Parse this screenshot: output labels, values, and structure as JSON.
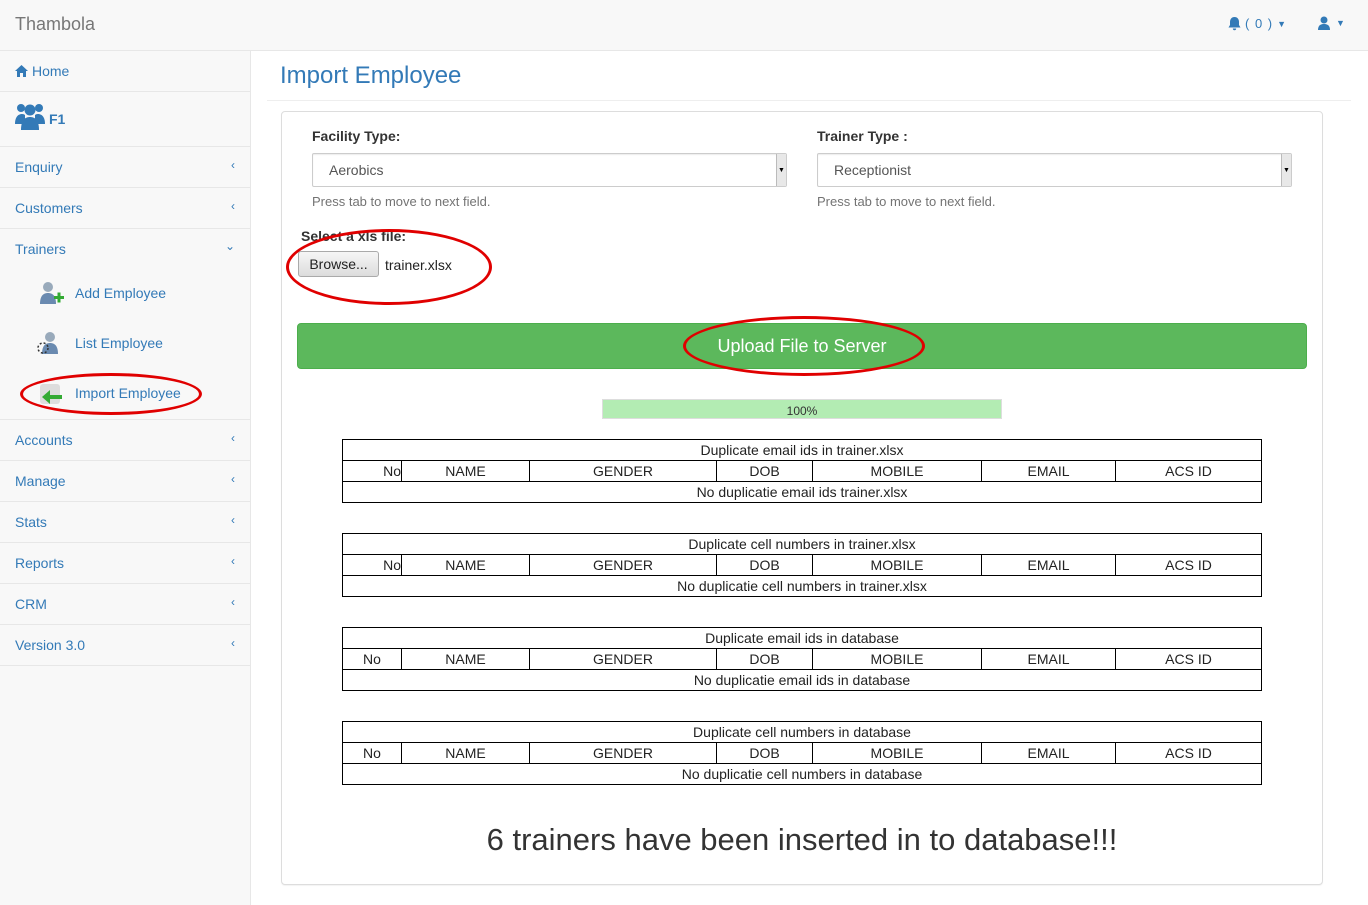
{
  "navbar": {
    "brand": "Thambola",
    "notif_label": "( 0 )"
  },
  "sidebar": {
    "home": "Home",
    "group": "F1",
    "items": [
      {
        "label": "Enquiry"
      },
      {
        "label": "Customers"
      },
      {
        "label": "Trainers"
      },
      {
        "label": "Accounts"
      },
      {
        "label": "Manage"
      },
      {
        "label": "Stats"
      },
      {
        "label": "Reports"
      },
      {
        "label": "CRM"
      },
      {
        "label": "Version 3.0"
      }
    ],
    "trainer_sub": [
      "Add Employee",
      "List Employee",
      "Import Employee"
    ]
  },
  "main": {
    "title": "Import Employee",
    "facility_label": "Facility Type:",
    "facility_value": "Aerobics",
    "trainer_label": "Trainer Type :",
    "trainer_value": "Receptionist",
    "help_text": "Press tab to move to next field.",
    "file_label": "Select a xls file:",
    "browse_label": "Browse...",
    "file_name": "trainer.xlsx",
    "upload_label": "Upload File to Server",
    "progress_text": "100%",
    "progress_value": 100,
    "columns": [
      "No",
      "NAME",
      "GENDER",
      "DOB",
      "MOBILE",
      "EMAIL",
      "ACS ID"
    ],
    "tables": [
      {
        "title": "Duplicate email ids in trainer.xlsx",
        "empty": "No duplicatie email ids trainer.xlsx"
      },
      {
        "title": "Duplicate cell numbers in trainer.xlsx",
        "empty": "No duplicatie cell numbers in trainer.xlsx"
      },
      {
        "title": "Duplicate email ids in database",
        "empty": "No duplicatie email ids in database"
      },
      {
        "title": "Duplicate cell numbers in database",
        "empty": "No duplicatie cell numbers in database"
      }
    ],
    "result": "6 trainers have been inserted in to database!!!"
  },
  "colors": {
    "link": "#337ab7",
    "success": "#5cb85c",
    "highlight": "#e00000"
  }
}
